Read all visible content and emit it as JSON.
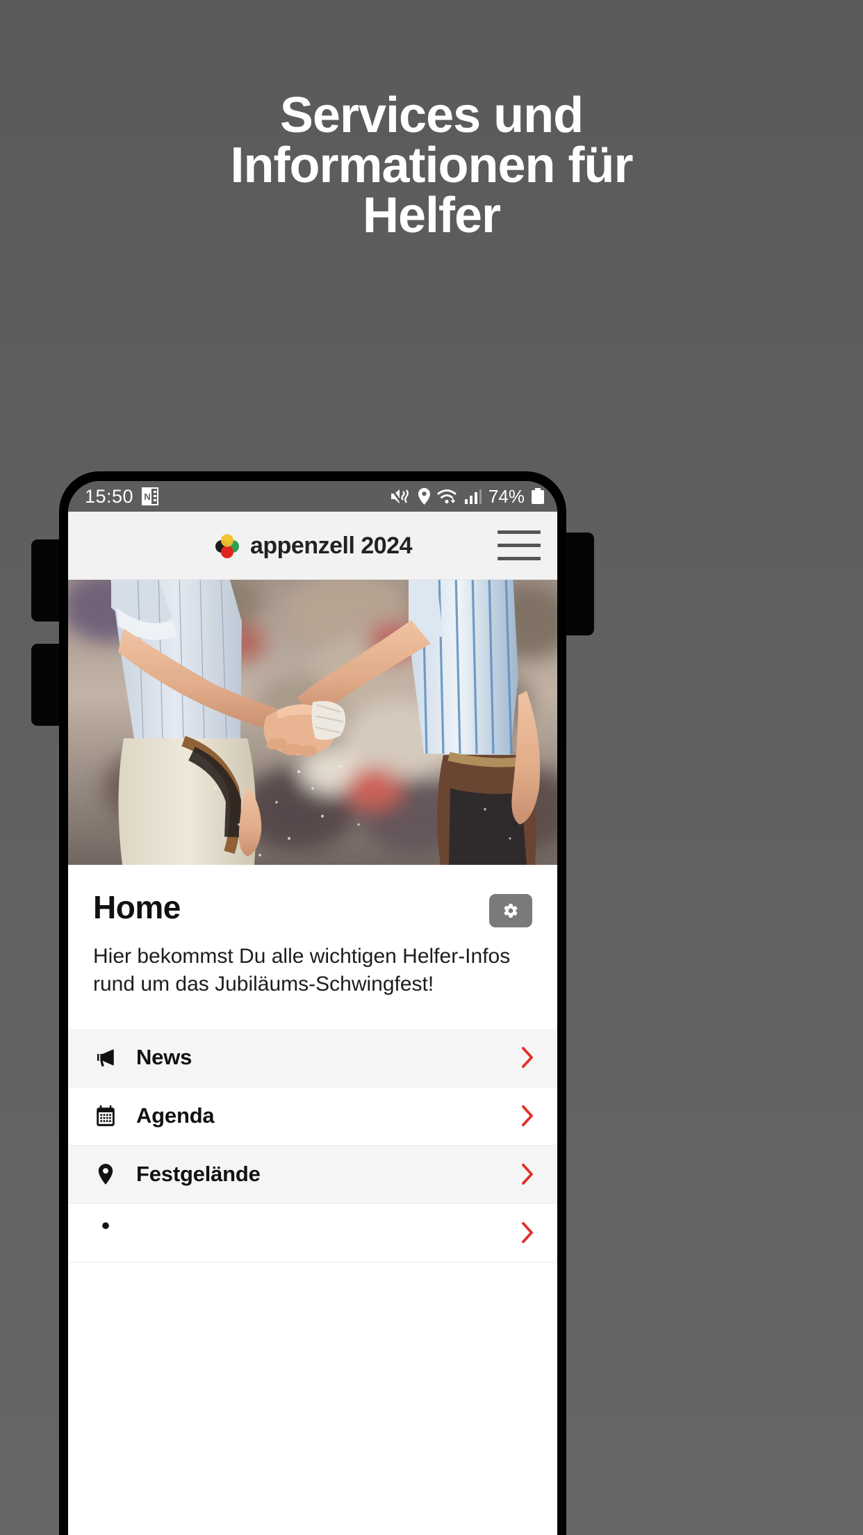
{
  "promo": {
    "headline_lines": [
      "Services und",
      "Informationen für",
      "Helfer"
    ],
    "background_color": "#5c5c5c",
    "headline_color": "#ffffff"
  },
  "phone": {
    "status_bar": {
      "time": "15:50",
      "battery_percent": "74%",
      "left_icons": [
        "onenote-icon"
      ],
      "right_icons": [
        "mute-vibrate-icon",
        "location-icon",
        "wifi-icon",
        "signal-bars-icon",
        "battery-icon"
      ],
      "background_color": "#5d5d5d"
    },
    "header": {
      "brand_name": "appenzell 2024",
      "logo_name": "appenzell-flower-logo",
      "logo_colors": [
        "#f2c230",
        "#1b1b1b",
        "#2f9e4f",
        "#e0231f"
      ],
      "menu_label": "hamburger-menu",
      "background_color": "#f2f2f2"
    },
    "hero": {
      "image_alt": "Zwei Schwinger geben sich die Hand",
      "image_name": "wrestlers-handshake-photo"
    },
    "content": {
      "title": "Home",
      "settings_label": "gear-icon",
      "description": "Hier bekommst Du alle wichtigen Helfer-Infos rund um das Jubiläums-Schwingfest!"
    },
    "nav_items": [
      {
        "label": "News",
        "icon": "megaphone-icon",
        "chevron": "chevron-right-icon",
        "shaded": true
      },
      {
        "label": "Agenda",
        "icon": "calendar-icon",
        "chevron": "chevron-right-icon",
        "shaded": false
      },
      {
        "label": "Festgelände",
        "icon": "location-pin-icon",
        "chevron": "chevron-right-icon",
        "shaded": true
      },
      {
        "label": "",
        "icon": "partial-icon",
        "chevron": "chevron-right-icon",
        "shaded": false
      }
    ],
    "accent_color": "#e03127"
  }
}
